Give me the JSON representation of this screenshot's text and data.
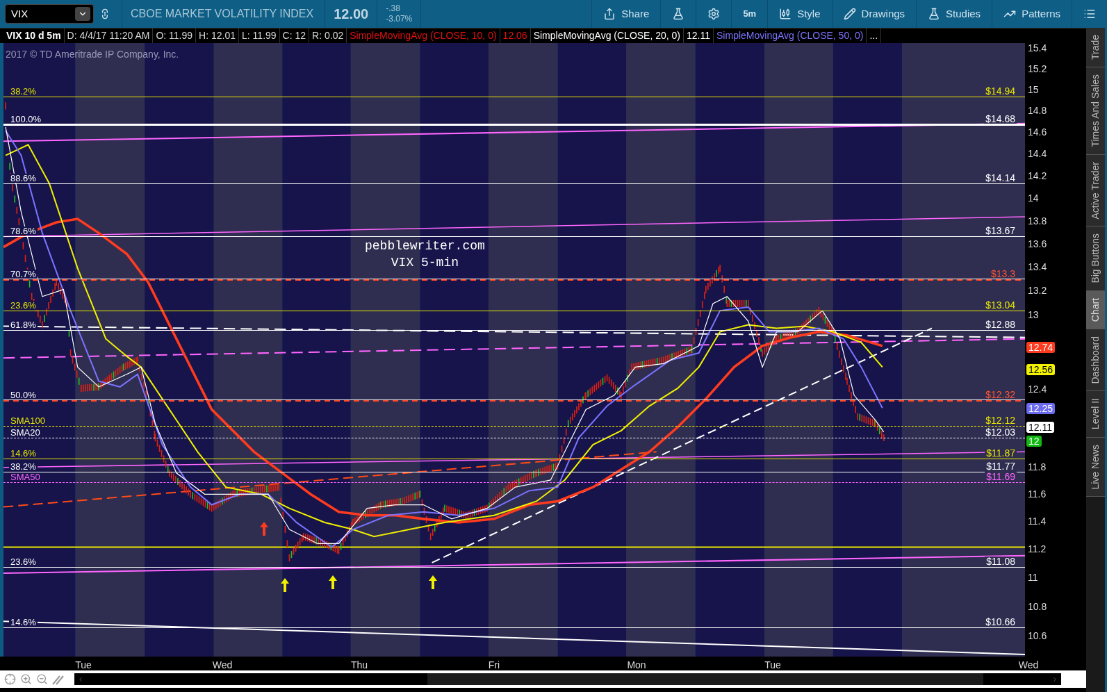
{
  "toolbar": {
    "symbol": "VIX",
    "title": "CBOE MARKET VOLATILITY INDEX",
    "last": "12.00",
    "change": "-.38",
    "change_pct": "-3.07%",
    "buttons": [
      {
        "kind": "share",
        "label": "Share"
      },
      {
        "kind": "flask"
      },
      {
        "kind": "gear"
      },
      {
        "kind": "interval",
        "label": "5m"
      },
      {
        "kind": "style",
        "label": "Style"
      },
      {
        "kind": "pencil",
        "label": "Drawings"
      },
      {
        "kind": "flask",
        "label": "Studies"
      },
      {
        "kind": "patterns",
        "label": "Patterns"
      },
      {
        "kind": "menu"
      }
    ]
  },
  "info_bar": [
    {
      "text": "VIX 10 d 5m",
      "kind": "title"
    },
    {
      "text": "D: 4/4/17 11:20 AM",
      "kind": "field"
    },
    {
      "text": "O: 11.99",
      "kind": "field"
    },
    {
      "text": "H: 12.01",
      "kind": "field"
    },
    {
      "text": "L: 11.99",
      "kind": "field"
    },
    {
      "text": "C: 12",
      "kind": "field"
    },
    {
      "text": "R: 0.02",
      "kind": "field"
    },
    {
      "text": "SimpleMovingAvg (CLOSE, 10, 0)",
      "kind": "study"
    },
    {
      "text": "12.06",
      "kind": "value"
    },
    {
      "text": "SimpleMovingAvg (CLOSE, 20, 0)",
      "kind": "study"
    },
    {
      "text": "12.11",
      "kind": "value"
    },
    {
      "text": "SimpleMovingAvg (CLOSE, 50, 0)",
      "kind": "study"
    },
    {
      "text": "...",
      "kind": "more"
    }
  ],
  "chart": {
    "copyright": "2017 © TD Ameritrade IP Company, Inc.",
    "annotation": [
      "pebblewriter.com",
      "VIX 5-min"
    ],
    "levels": [
      {
        "label": "38.2%",
        "price": "$14.94",
        "color": "#e8e800",
        "kind": "solid"
      },
      {
        "label": "100.0%",
        "price": "$14.68",
        "color": "#ffffff",
        "kind": "thick"
      },
      {
        "label": "88.6%",
        "price": "$14.14",
        "color": "#ffffff",
        "kind": "solid"
      },
      {
        "label": "78.6%",
        "price": "$13.67",
        "color": "#ffffff",
        "kind": "solid"
      },
      {
        "label": "70.7%",
        "price": "$13.3",
        "color": "#ffffff",
        "kind": "double"
      },
      {
        "label": "23.6%",
        "price": "$13.04",
        "color": "#e8e800",
        "kind": "solid"
      },
      {
        "label": "61.8%",
        "price": "$12.88",
        "color": "#ffffff",
        "kind": "solid"
      },
      {
        "label": "50.0%",
        "price": "$12.32",
        "color": "#ffffff",
        "kind": "double"
      },
      {
        "label": "SMA100",
        "price": "$12.12",
        "color": "#e8e800",
        "kind": "dashed"
      },
      {
        "label": "SMA20",
        "price": "$12.03",
        "color": "#ffffff",
        "kind": "dashed"
      },
      {
        "label": "14.6%",
        "price": "$11.87",
        "color": "#e8e800",
        "kind": "solid"
      },
      {
        "label": "38.2%",
        "price": "$11.77",
        "color": "#ffffff",
        "kind": "solid"
      },
      {
        "label": "SMA50",
        "price": "$11.69",
        "color": "#ff66ff",
        "kind": "dashed"
      },
      {
        "label": "23.6%",
        "price": "$11.08",
        "color": "#ffffff",
        "kind": "solid"
      },
      {
        "label": "14.6%",
        "price": "$10.66",
        "color": "#ffffff",
        "kind": "solid"
      }
    ],
    "y_ticks": [
      "15.4",
      "15.2",
      "15",
      "14.8",
      "14.6",
      "14.4",
      "14.2",
      "14",
      "13.8",
      "13.6",
      "13.4",
      "13.2",
      "13",
      "12.4",
      "11.8",
      "11.6",
      "11.4",
      "11.2",
      "11",
      "10.8",
      "10.6"
    ],
    "price_badges": [
      {
        "value": "12.74",
        "color": "#ff3b1f"
      },
      {
        "value": "12.56",
        "color": "#f2f200"
      },
      {
        "value": "12.25",
        "color": "#6b6bf0"
      },
      {
        "value": "12.11",
        "color": "#ffffff"
      },
      {
        "value": "12",
        "color": "#14b814"
      }
    ],
    "days": [
      "Tue",
      "Wed",
      "Thu",
      "Fri",
      "Mon",
      "Tue",
      "Wed"
    ]
  },
  "side_tabs": [
    {
      "label": "Trade",
      "selected": false
    },
    {
      "label": "Times And Sales",
      "selected": false
    },
    {
      "label": "Active Trader",
      "selected": false
    },
    {
      "label": "Big Buttons",
      "selected": false
    },
    {
      "label": "Chart",
      "selected": true
    },
    {
      "label": "Dashboard",
      "selected": false
    },
    {
      "label": "Level II",
      "selected": false
    },
    {
      "label": "Live News",
      "selected": false
    }
  ]
}
